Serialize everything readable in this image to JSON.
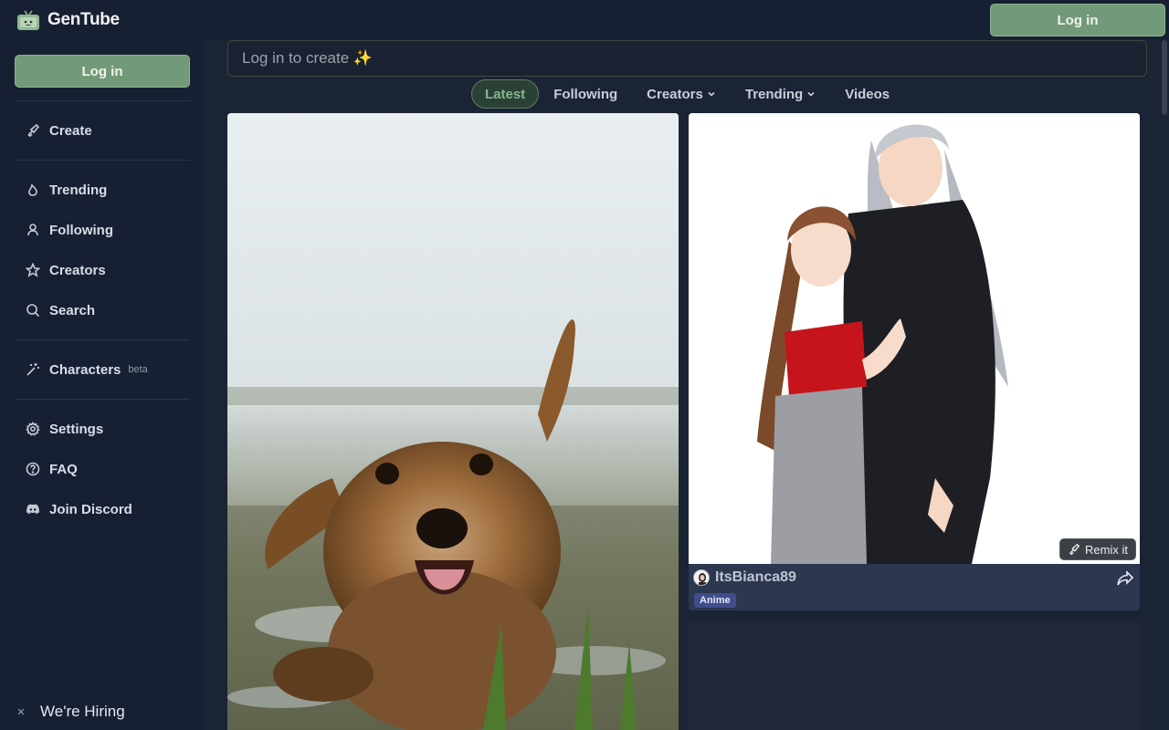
{
  "app": {
    "title": "GenTube"
  },
  "header": {
    "login_label": "Log in"
  },
  "sidebar": {
    "login_label": "Log in",
    "items": [
      {
        "label": "Create",
        "icon": "brush-icon"
      },
      {
        "label": "Trending",
        "icon": "flame-icon"
      },
      {
        "label": "Following",
        "icon": "user-icon"
      },
      {
        "label": "Creators",
        "icon": "star-icon"
      },
      {
        "label": "Search",
        "icon": "search-icon"
      },
      {
        "label": "Characters",
        "icon": "magic-wand-icon",
        "badge": "beta"
      },
      {
        "label": "Settings",
        "icon": "gear-icon"
      },
      {
        "label": "FAQ",
        "icon": "question-icon"
      },
      {
        "label": "Join Discord",
        "icon": "discord-icon"
      }
    ],
    "hiring_label": "We're Hiring"
  },
  "main": {
    "prompt_placeholder": "Log in to create ✨",
    "tabs": [
      {
        "label": "Latest",
        "active": true
      },
      {
        "label": "Following"
      },
      {
        "label": "Creators",
        "dropdown": true
      },
      {
        "label": "Trending",
        "dropdown": true
      },
      {
        "label": "Videos"
      }
    ],
    "cards": [
      {
        "image": "wet terrier dog lying in muddy grass field"
      },
      {
        "image": "anime couple illustration",
        "remix_label": "Remix it",
        "author": "ItsBianca89",
        "tag": "Anime"
      }
    ]
  },
  "colors": {
    "accent": "#739a78",
    "background": "#1a2233",
    "tag": "#3f4d8a"
  }
}
